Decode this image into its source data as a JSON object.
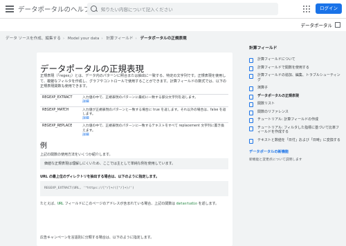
{
  "header": {
    "site_title": "データポータルのヘルプ",
    "search_placeholder": "知りたい内容について記入ください",
    "login_label": "ログイン"
  },
  "subbar": {
    "product_link": "データポータル"
  },
  "breadcrumbs": [
    {
      "label": "データ ソースを作成、編集する"
    },
    {
      "label": "Model your data"
    },
    {
      "label": "計算フィールド"
    },
    {
      "label": "データポータルの正規表現"
    }
  ],
  "article": {
    "title": "データポータルの正規表現",
    "intro": "正規表現（「regex」）とは、データ内のパターンに照合または抽出に一致する、特定の文字列です。正規表現を使用して、複雑なフィルタを作成し、グラフやコントロールで使用することができます。計算フィールドの数式では、以下の正規表現関数も使用できます。",
    "functions": [
      {
        "name": "REGEXP_EXTRACT",
        "desc": "入力値の中で、正規表現のパターンに最初に一致する部分文字列を返します。",
        "link": "詳細"
      },
      {
        "name": "REGEXP_MATCH",
        "desc": "入力値が正規表現のパターンと一致する場合に true を返します。それ以外の場合は、false を返します。",
        "link": "詳細"
      },
      {
        "name": "REGEXP_REPLACE",
        "desc": "入力値の中で、正規表現のパターンに一致するテキストをすべて replacement 文字列に置き換えます。",
        "link": "詳細"
      }
    ],
    "examples_heading": "例",
    "examples_intro": "上記の関数の使用方法をいくつか紹介します。",
    "note": "価値な正規表現は理解しにくいため、ここでは主として単純な例を使用しています。",
    "example1_heading": "URL の最上位のディレクトリを抽出する場合は、以下のように指定します。",
    "example1_code": "REGEXP_EXTRACT(URL, '^https://[^/]+/([^/]+)/')",
    "example1_desc_prefix": "たとえば、",
    "example1_desc_code": "URL",
    "example1_desc_mid": " フィールドにこのページのアドレスが含まれている場合、上記の関数は ",
    "example1_desc_code2": "datastudio",
    "example1_desc_suffix": " を返します。",
    "example2_heading": "広告キャンペーンを言語別に分類する場合は、以下のように指定します。"
  },
  "toc": {
    "title": "計算フィールド",
    "items": [
      {
        "label": "計算フィールドについて",
        "active": false
      },
      {
        "label": "計算フィールドで関数を使用する",
        "active": false
      },
      {
        "label": "計算フィールドの追加、編集、トラブルシューティング",
        "active": false
      },
      {
        "label": "演算子",
        "active": false
      },
      {
        "label": "データポータルの正規表現",
        "active": true
      },
      {
        "label": "関数リスト",
        "active": false
      },
      {
        "label": "関数のリファレンス",
        "active": false
      },
      {
        "label": "チュートリアル: 計算フィールドの作成",
        "active": false
      },
      {
        "label": "チュートリアル: フィルタした指標に基づいて比率フィールドを作成する",
        "active": false
      },
      {
        "label": "テキストと数値を「日付」および「日時」に変換する",
        "active": false
      }
    ],
    "sub_title": "データポータルの新機能",
    "sub_item": "新機能と変更点について説明します"
  },
  "colors": {
    "accent": "#1a73e8",
    "background": "#f1f3f4"
  }
}
